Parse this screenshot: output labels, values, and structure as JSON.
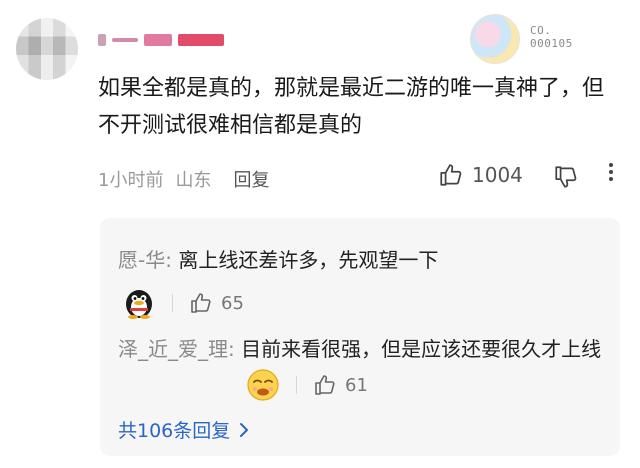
{
  "comment": {
    "text": "如果全都是真的，那就是最近二游的唯一真神了，但不开测试很难相信都是真的",
    "time": "1小时前",
    "location": "山东",
    "reply_label": "回复",
    "likes": "1004"
  },
  "badge": {
    "line1": "CO.",
    "line2": "000105"
  },
  "replies": [
    {
      "name": "愿-华",
      "sep": ": ",
      "text": "离上线还差许多，先观望一下",
      "likes": "65",
      "emoji": "qq-penguin-icon"
    },
    {
      "name": "泽_近_爱_理",
      "sep": ": ",
      "text": "目前来看很强，但是应该还要很久才上线",
      "likes": "61",
      "emoji": "smirk-face-icon"
    }
  ],
  "replies_total": "共106条回复",
  "colors": {
    "link": "#2b65c7",
    "reply_bg": "#f6f6f7",
    "muted": "#9a9a9a"
  }
}
